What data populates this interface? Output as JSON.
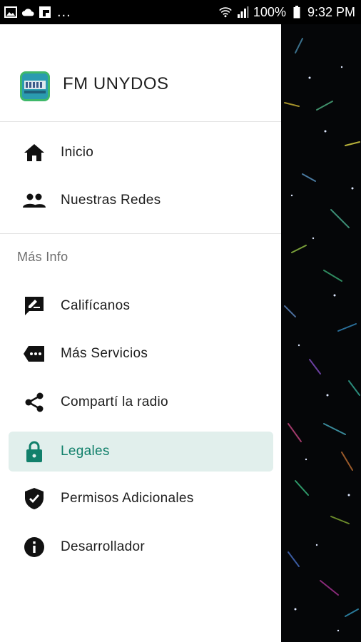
{
  "status_bar": {
    "battery": "100%",
    "time": "9:32 PM",
    "overflow": "..."
  },
  "drawer": {
    "app_title": "FM UNYDOS",
    "primary_items": [
      {
        "label": "Inicio",
        "icon": "home-icon"
      },
      {
        "label": "Nuestras Redes",
        "icon": "people-icon"
      }
    ],
    "section_title": "Más Info",
    "secondary_items": [
      {
        "label": "Califícanos",
        "icon": "rate-review-icon"
      },
      {
        "label": "Más Servicios",
        "icon": "label-tag-icon"
      },
      {
        "label": "Compartí la radio",
        "icon": "share-icon"
      },
      {
        "label": "Legales",
        "icon": "lock-icon",
        "selected": true
      },
      {
        "label": "Permisos Adicionales",
        "icon": "verified-shield-icon"
      },
      {
        "label": "Desarrollador",
        "icon": "info-icon"
      }
    ]
  },
  "colors": {
    "selected_bg": "#e1efec",
    "selected_text": "#11806b",
    "backdrop": "#050608"
  }
}
